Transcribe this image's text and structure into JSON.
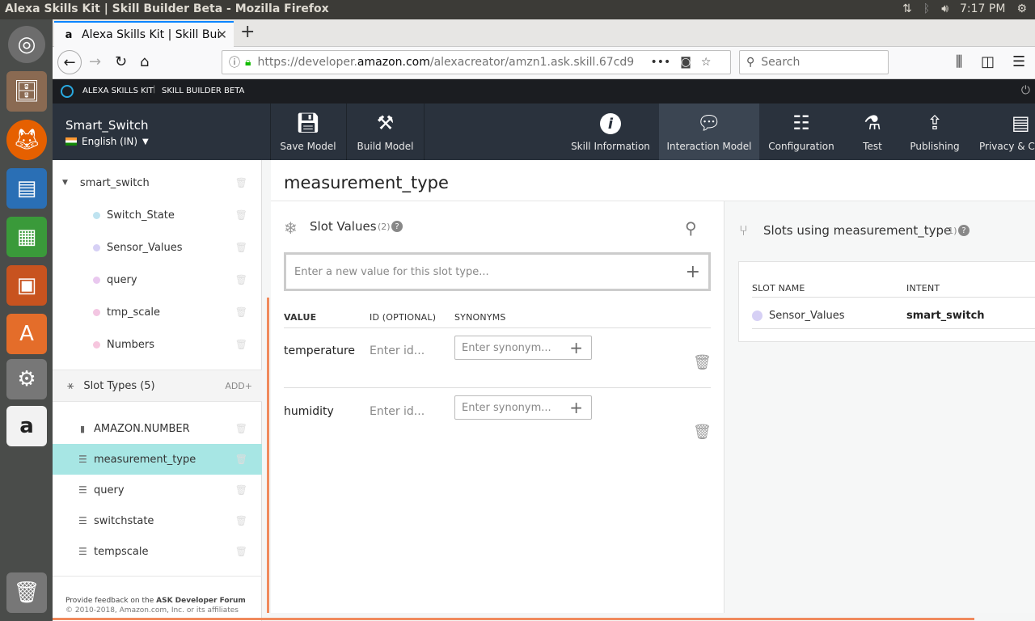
{
  "os": {
    "window_title": "Alexa Skills Kit | Skill Builder Beta - Mozilla Firefox",
    "clock": "7:17 PM"
  },
  "browser": {
    "tab_title": "Alexa Skills Kit | Skill Buil",
    "url_prefix": "https://developer.",
    "url_domain": "amazon.com",
    "url_rest": "/alexacreator/amzn1.ask.skill.67cd9",
    "search_placeholder": "Search"
  },
  "ask": {
    "brand": "ALEXA SKILLS KIT",
    "subbrand": "SKILL BUILDER BETA"
  },
  "skill": {
    "name": "Smart_Switch",
    "locale": "English (IN)"
  },
  "toolbar": {
    "save": "Save Model",
    "build": "Build Model",
    "skill_info": "Skill Information",
    "interaction": "Interaction Model",
    "configuration": "Configuration",
    "test": "Test",
    "publishing": "Publishing",
    "privacy": "Privacy & Co"
  },
  "sidebar": {
    "intent": "smart_switch",
    "slots": [
      {
        "label": "Switch_State",
        "color": "#bfe3f0"
      },
      {
        "label": "Sensor_Values",
        "color": "#d6d0f5"
      },
      {
        "label": "query",
        "color": "#e9c8ef"
      },
      {
        "label": "tmp_scale",
        "color": "#f3c6e2"
      },
      {
        "label": "Numbers",
        "color": "#f6c6de"
      }
    ],
    "slot_types_label": "Slot Types (5)",
    "add_label": "ADD",
    "slot_types": [
      "AMAZON.NUMBER",
      "measurement_type",
      "query",
      "switchstate",
      "tempscale"
    ],
    "selected_slot_type": "measurement_type",
    "feedback_prefix": "Provide feedback on the ",
    "feedback_link": "ASK Developer Forum",
    "copyright": "© 2010-2018, Amazon.com, Inc. or its affiliates"
  },
  "main": {
    "title": "measurement_type",
    "slot_values_label": "Slot Values",
    "slot_values_count": "(2)",
    "new_value_placeholder": "Enter a new value for this slot type...",
    "col_value": "VALUE",
    "col_id": "ID (OPTIONAL)",
    "col_synonyms": "SYNONYMS",
    "rows": [
      {
        "value": "temperature",
        "id_placeholder": "Enter id...",
        "syn_placeholder": "Enter synonym..."
      },
      {
        "value": "humidity",
        "id_placeholder": "Enter id...",
        "syn_placeholder": "Enter synonym..."
      }
    ]
  },
  "right": {
    "title": "Slots using measurement_type",
    "count": "(1)",
    "col_slot_name": "SLOT NAME",
    "col_intent": "INTENT",
    "slot_name": "Sensor_Values",
    "intent": "smart_switch"
  },
  "colors": {
    "accent_teal": "#a7e6e4",
    "orange_accent": "#f08a5d",
    "toolbar_bg": "#2a323d"
  }
}
